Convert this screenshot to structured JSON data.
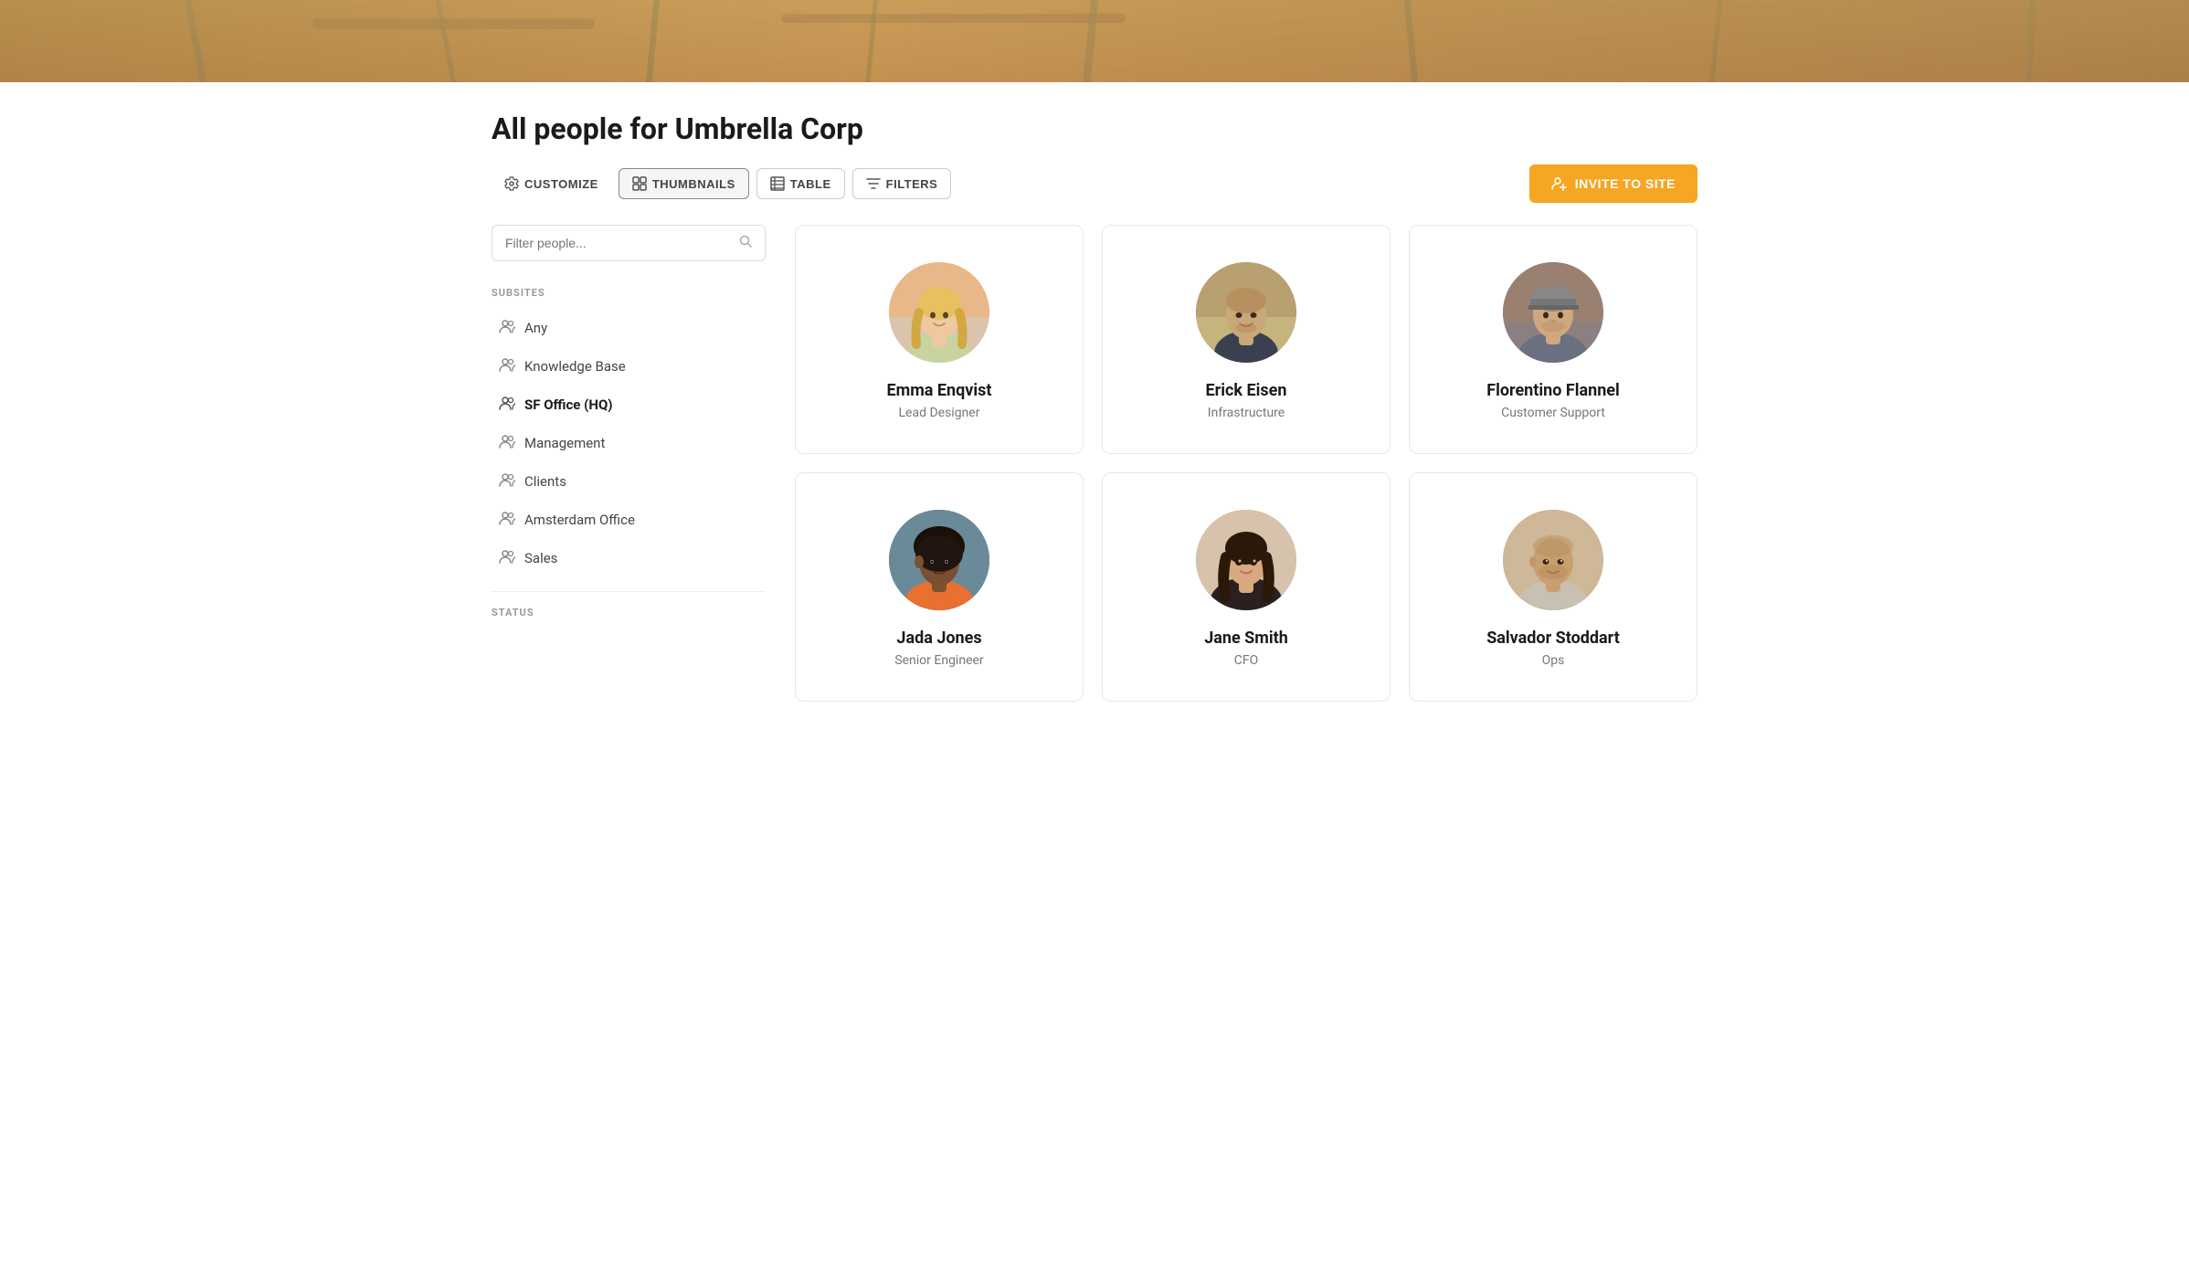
{
  "hero": {
    "alt": "Office rooftop background"
  },
  "page": {
    "title": "All people for Umbrella Corp"
  },
  "toolbar": {
    "customize_label": "CUSTOMIZE",
    "thumbnails_label": "THUMBNAILS",
    "table_label": "TABLE",
    "filters_label": "FILTERS",
    "invite_label": "INVITE TO SITE"
  },
  "sidebar": {
    "search_placeholder": "Filter people...",
    "subsites_label": "SUBSITES",
    "status_label": "STATUS",
    "items": [
      {
        "id": "any",
        "label": "Any",
        "active": false
      },
      {
        "id": "knowledge-base",
        "label": "Knowledge Base",
        "active": false
      },
      {
        "id": "sf-office",
        "label": "SF Office (HQ)",
        "active": true
      },
      {
        "id": "management",
        "label": "Management",
        "active": false
      },
      {
        "id": "clients",
        "label": "Clients",
        "active": false
      },
      {
        "id": "amsterdam-office",
        "label": "Amsterdam Office",
        "active": false
      },
      {
        "id": "sales",
        "label": "Sales",
        "active": false
      }
    ]
  },
  "people": [
    {
      "id": "emma-enqvist",
      "name": "Emma Enqvist",
      "role": "Lead Designer",
      "avatar_class": "avatar-emma"
    },
    {
      "id": "erick-eisen",
      "name": "Erick Eisen",
      "role": "Infrastructure",
      "avatar_class": "avatar-erick"
    },
    {
      "id": "florentino-flannel",
      "name": "Florentino Flannel",
      "role": "Customer Support",
      "avatar_class": "avatar-florentino"
    },
    {
      "id": "jada-jones",
      "name": "Jada Jones",
      "role": "Senior Engineer",
      "avatar_class": "avatar-jada"
    },
    {
      "id": "jane-smith",
      "name": "Jane Smith",
      "role": "CFO",
      "avatar_class": "avatar-jane"
    },
    {
      "id": "salvador-stoddart",
      "name": "Salvador Stoddart",
      "role": "Ops",
      "avatar_class": "avatar-salvador"
    }
  ]
}
